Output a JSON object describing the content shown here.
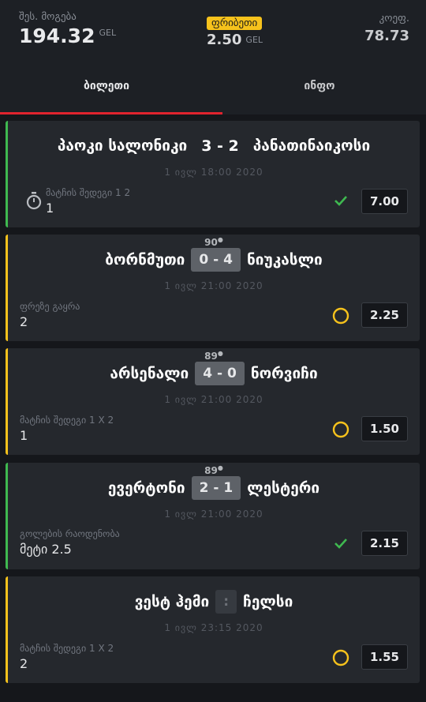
{
  "header": {
    "stake_label": "შეს. მოგება",
    "stake_value": "194.32",
    "stake_currency": "GEL",
    "freebet_label": "ფრიბეთი",
    "freebet_value": "2.50",
    "freebet_currency": "GEL",
    "odds_label": "კოეფ.",
    "odds_value": "78.73"
  },
  "tabs": [
    {
      "label": "ბილეთი",
      "active": true
    },
    {
      "label": "ინფო",
      "active": false
    }
  ],
  "colors": {
    "accent": "#e0232e",
    "pending": "#f6c21c",
    "won": "#3fb950"
  },
  "bets": [
    {
      "home": "პაოკი სალონიკი",
      "score": "3 - 2",
      "away": "პანათინაიკოსი",
      "minute": "",
      "date": "1 ივლ 18:00 2020",
      "bet_type": "მატჩის შედეგი 1 2",
      "pick": "1",
      "odd": "7.00",
      "status": "won",
      "icon": "stopwatch-icon"
    },
    {
      "home": "ბორნმუთი",
      "score": "0 - 4",
      "away": "ნიუკასლი",
      "minute": "90",
      "date": "1 ივლ 21:00 2020",
      "bet_type": "ფრეზე გაყრა",
      "pick": "2",
      "odd": "2.25",
      "status": "pending"
    },
    {
      "home": "არსენალი",
      "score": "4 - 0",
      "away": "ნორვიჩი",
      "minute": "89",
      "date": "1 ივლ 21:00 2020",
      "bet_type": "მატჩის შედეგი 1 X 2",
      "pick": "1",
      "odd": "1.50",
      "status": "pending"
    },
    {
      "home": "ევერტონი",
      "score": "2 - 1",
      "away": "ლესტერი",
      "minute": "89",
      "date": "1 ივლ 21:00 2020",
      "bet_type": "გოლების რაოდენობა",
      "pick": "მეტი 2.5",
      "odd": "2.15",
      "status": "won"
    },
    {
      "home": "ვესტ ჰემი",
      "score": ":",
      "away": "ჩელსი",
      "minute": "",
      "date": "1 ივლ 23:15 2020",
      "bet_type": "მატჩის შედეგი 1 X 2",
      "pick": "2",
      "odd": "1.55",
      "status": "pending"
    }
  ]
}
